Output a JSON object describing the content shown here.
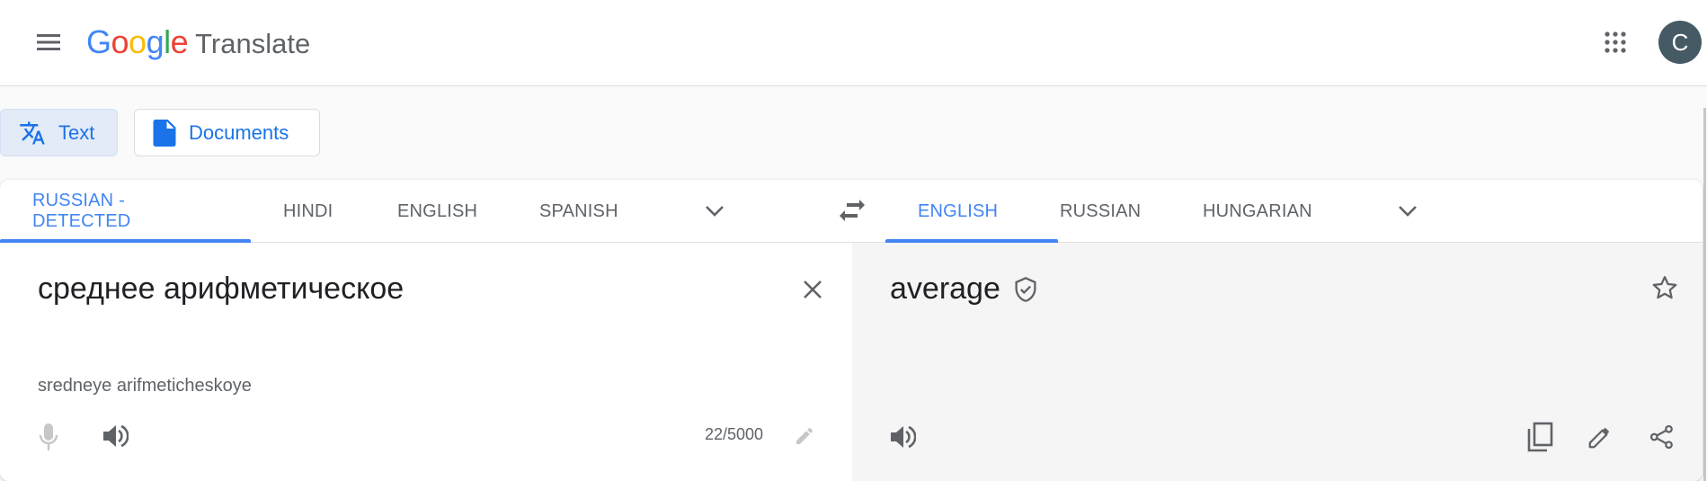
{
  "header": {
    "menu_icon": "hamburger-menu-icon",
    "logo": {
      "letters": [
        {
          "ch": "G",
          "color": "#4285f4"
        },
        {
          "ch": "o",
          "color": "#ea4335"
        },
        {
          "ch": "o",
          "color": "#fbbc05"
        },
        {
          "ch": "g",
          "color": "#4285f4"
        },
        {
          "ch": "l",
          "color": "#34a853"
        },
        {
          "ch": "e",
          "color": "#ea4335"
        }
      ],
      "product": "Translate"
    },
    "apps_icon": "apps-grid-icon",
    "avatar_initial": "C",
    "avatar_color": "#455a64"
  },
  "modes": [
    {
      "label": "Text",
      "icon": "translate-icon",
      "active": true
    },
    {
      "label": "Documents",
      "icon": "document-icon",
      "active": false
    }
  ],
  "source_tabs": [
    {
      "label": "RUSSIAN - DETECTED",
      "active": true
    },
    {
      "label": "HINDI",
      "active": false
    },
    {
      "label": "ENGLISH",
      "active": false
    },
    {
      "label": "SPANISH",
      "active": false
    }
  ],
  "target_tabs": [
    {
      "label": "ENGLISH",
      "active": true
    },
    {
      "label": "RUSSIAN",
      "active": false
    },
    {
      "label": "HUNGARIAN",
      "active": false
    }
  ],
  "source": {
    "text": "среднее арифметическое",
    "transliteration": "sredneye arifmeticheskoye",
    "char_count": "22/5000"
  },
  "target": {
    "text": "average"
  },
  "colors": {
    "accent": "#4285f4",
    "link_blue": "#1a73e8",
    "icon_gray": "#5f6368",
    "disabled_gray": "#c7c7c7"
  }
}
